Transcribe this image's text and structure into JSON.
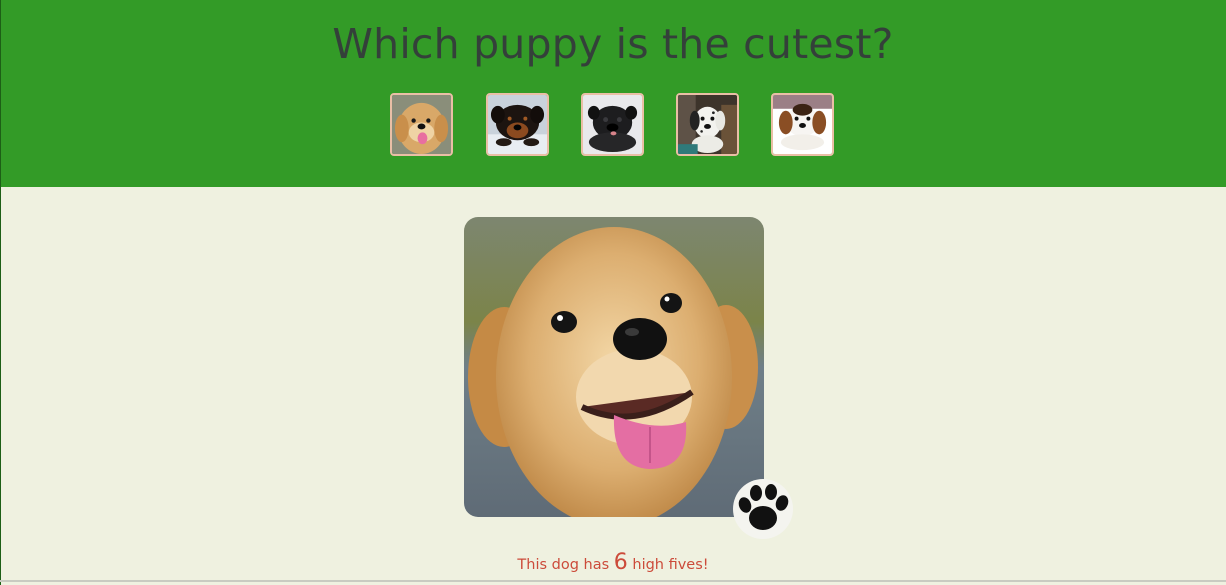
{
  "page": {
    "title": "Which puppy is the cutest?"
  },
  "thumbnails": [
    {
      "name": "golden-retriever-puppy",
      "selected": true
    },
    {
      "name": "rottweiler-puppy",
      "selected": false
    },
    {
      "name": "black-pug-puppy",
      "selected": false
    },
    {
      "name": "dalmatian-puppy",
      "selected": false
    },
    {
      "name": "beagle-puppy",
      "selected": false
    }
  ],
  "main": {
    "photo": "golden-retriever-puppy",
    "paw_icon": "paw-print-icon"
  },
  "caption": {
    "prefix": "This dog has",
    "count": "6",
    "suffix": "high fives!"
  },
  "colors": {
    "header_bg": "#339b27",
    "page_bg": "#eff1e0",
    "title_text": "#34403a",
    "caption_text": "#cc4b3a",
    "thumb_border": "#eabfa6"
  }
}
